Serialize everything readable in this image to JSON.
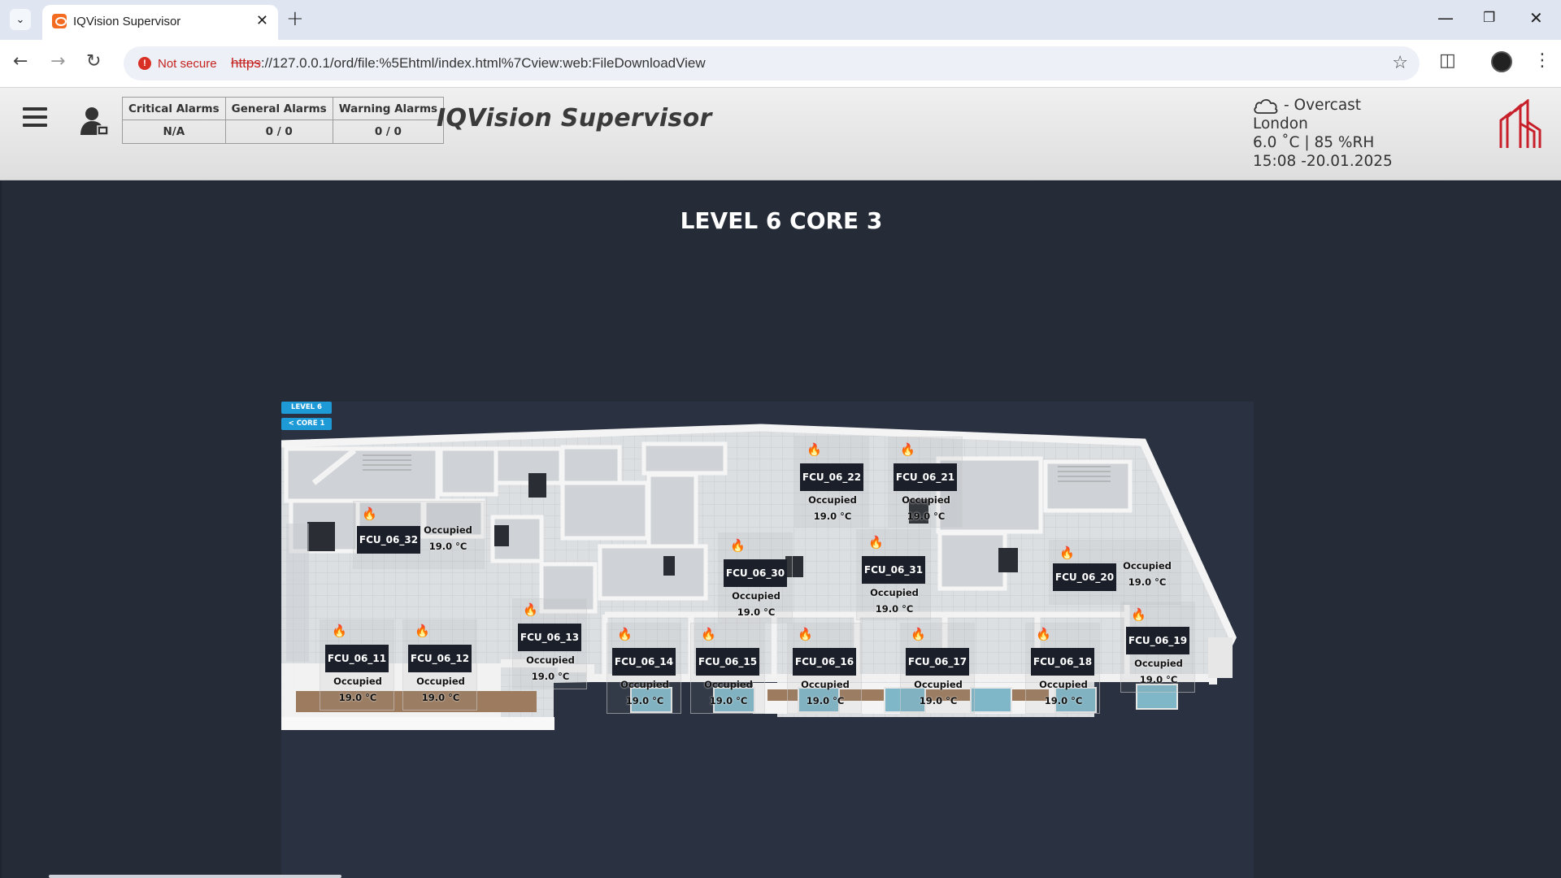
{
  "browser": {
    "tab_title": "IQVision Supervisor",
    "security_label": "Not secure",
    "url_scheme": "https",
    "url_rest": "://127.0.0.1/ord/file:%5Ehtml/index.html%7Cview:web:FileDownloadView"
  },
  "header": {
    "alarms": {
      "headers": [
        "Critical Alarms",
        "General Alarms",
        "Warning Alarms"
      ],
      "values": [
        "N/A",
        "0 / 0",
        "0 / 0"
      ]
    },
    "title": "IQVision Supervisor",
    "weather": {
      "condition": "- Overcast",
      "city": "London",
      "reading": "6.0 ˚C | 85 %RH",
      "datetime": "15:08 -20.01.2025",
      "icon": "cloud-icon"
    }
  },
  "page": {
    "title": "LEVEL 6 CORE 3",
    "nav": {
      "level": "LEVEL 6",
      "core": "< CORE 1"
    }
  },
  "fcus": [
    {
      "name": "FCU_06_22",
      "status": "Occupied",
      "temp": "19.0 °C"
    },
    {
      "name": "FCU_06_21",
      "status": "Occupied",
      "temp": "19.0 °C"
    },
    {
      "name": "FCU_06_32",
      "status": "Occupied",
      "temp": "19.0 °C"
    },
    {
      "name": "FCU_06_30",
      "status": "Occupied",
      "temp": "19.0 °C"
    },
    {
      "name": "FCU_06_31",
      "status": "Occupied",
      "temp": "19.0 °C"
    },
    {
      "name": "FCU_06_20",
      "status": "Occupied",
      "temp": "19.0 °C"
    },
    {
      "name": "FCU_06_13",
      "status": "Occupied",
      "temp": "19.0 °C"
    },
    {
      "name": "FCU_06_19",
      "status": "Occupied",
      "temp": "19.0 °C"
    },
    {
      "name": "FCU_06_11",
      "status": "Occupied",
      "temp": "19.0 °C"
    },
    {
      "name": "FCU_06_12",
      "status": "Occupied",
      "temp": "19.0 °C"
    },
    {
      "name": "FCU_06_14",
      "status": "Occupied",
      "temp": "19.0 °C"
    },
    {
      "name": "FCU_06_15",
      "status": "Occupied",
      "temp": "19.0 °C"
    },
    {
      "name": "FCU_06_16",
      "status": "Occupied",
      "temp": "19.0 °C"
    },
    {
      "name": "FCU_06_17",
      "status": "Occupied",
      "temp": "19.0 °C"
    },
    {
      "name": "FCU_06_18",
      "status": "Occupied",
      "temp": "19.0 °C"
    }
  ],
  "colors": {
    "heating_flame": "#d21e1e",
    "nav_accent": "#1e9ad6",
    "background": "#252b37"
  }
}
